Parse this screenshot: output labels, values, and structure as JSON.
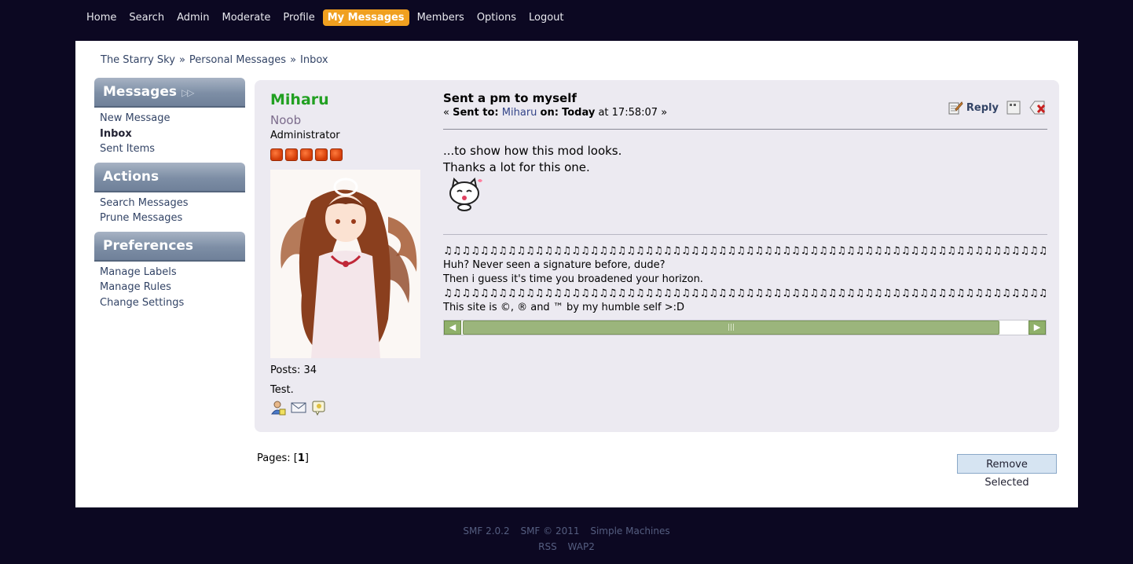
{
  "nav": {
    "items": [
      "Home",
      "Search",
      "Admin",
      "Moderate",
      "Profile",
      "My Messages",
      "Members",
      "Options",
      "Logout"
    ],
    "active": "My Messages"
  },
  "breadcrumb": [
    "The Starry Sky",
    "Personal Messages",
    "Inbox"
  ],
  "breadcrumb_separator": "»",
  "sidebar": {
    "sections": [
      {
        "title": "Messages",
        "items": [
          "New Message",
          "Inbox",
          "Sent Items"
        ],
        "current": "Inbox"
      },
      {
        "title": "Actions",
        "items": [
          "Search Messages",
          "Prune Messages"
        ]
      },
      {
        "title": "Preferences",
        "items": [
          "Manage Labels",
          "Manage Rules",
          "Change Settings"
        ]
      }
    ]
  },
  "poster": {
    "name": "Miharu",
    "title": "Noob",
    "group": "Administrator",
    "stars": 5,
    "posts": "Posts: 34",
    "personal_text": "Test.",
    "icons": [
      "profile-icon",
      "email-icon",
      "personal-message-icon"
    ]
  },
  "message": {
    "subject": "Sent a pm to myself",
    "sent_prefix": "«",
    "sent_to_label": "Sent to:",
    "sent_to": "Miharu",
    "on_label": "on:",
    "date": "Today",
    "time": "at 17:58:07",
    "sent_suffix": "»",
    "reply_label": "Reply",
    "body_lines": [
      "...to show how this mod looks.",
      "Thanks a lot for this one."
    ],
    "signature_lines": [
      "♫♫♫♫♫♫♫♫♫♫♫♫♫♫♫♫♫♫♫♫♫♫♫♫♫♫♫♫♫♫♫♫♫♫♫♫♫♫♫♫♫♫♫♫♫♫♫♫♫♫♫♫♫♫♫♫♫♫♫♫♫♫♫♫♫♫♫♫♫♫♫♫♫♫♫♫♫♫♫♫♫♫♫♫♫♫♫♫♫♫",
      "Huh? Never seen a signature before, dude?",
      "Then i guess it's time you broadened your horizon.",
      "♫♫♫♫♫♫♫♫♫♫♫♫♫♫♫♫♫♫♫♫♫♫♫♫♫♫♫♫♫♫♫♫♫♫♫♫♫♫♫♫♫♫♫♫♫♫♫♫♫♫♫♫♫♫♫♫♫♫♫♫♫♫♫♫♫♫♫♫♫♫♫♫♫♫♫♫♫♫♫♫♫♫♫♫♫♫♫♫♫♫",
      "This site is ©, ® and ™ by my humble self >:D"
    ]
  },
  "pages": {
    "label": "Pages:",
    "current": "1"
  },
  "remove_button": "Remove Selected",
  "footer": {
    "line1": [
      "SMF 2.0.2",
      "SMF © 2011",
      "Simple Machines"
    ],
    "line2": [
      "RSS",
      "WAP2"
    ]
  },
  "colors": {
    "background": "#0c0822",
    "active_nav": "#f0a020",
    "poster_name": "#22a022",
    "sidebar_header": "#7d8ea5",
    "scrollbar": "#9bb57c"
  }
}
